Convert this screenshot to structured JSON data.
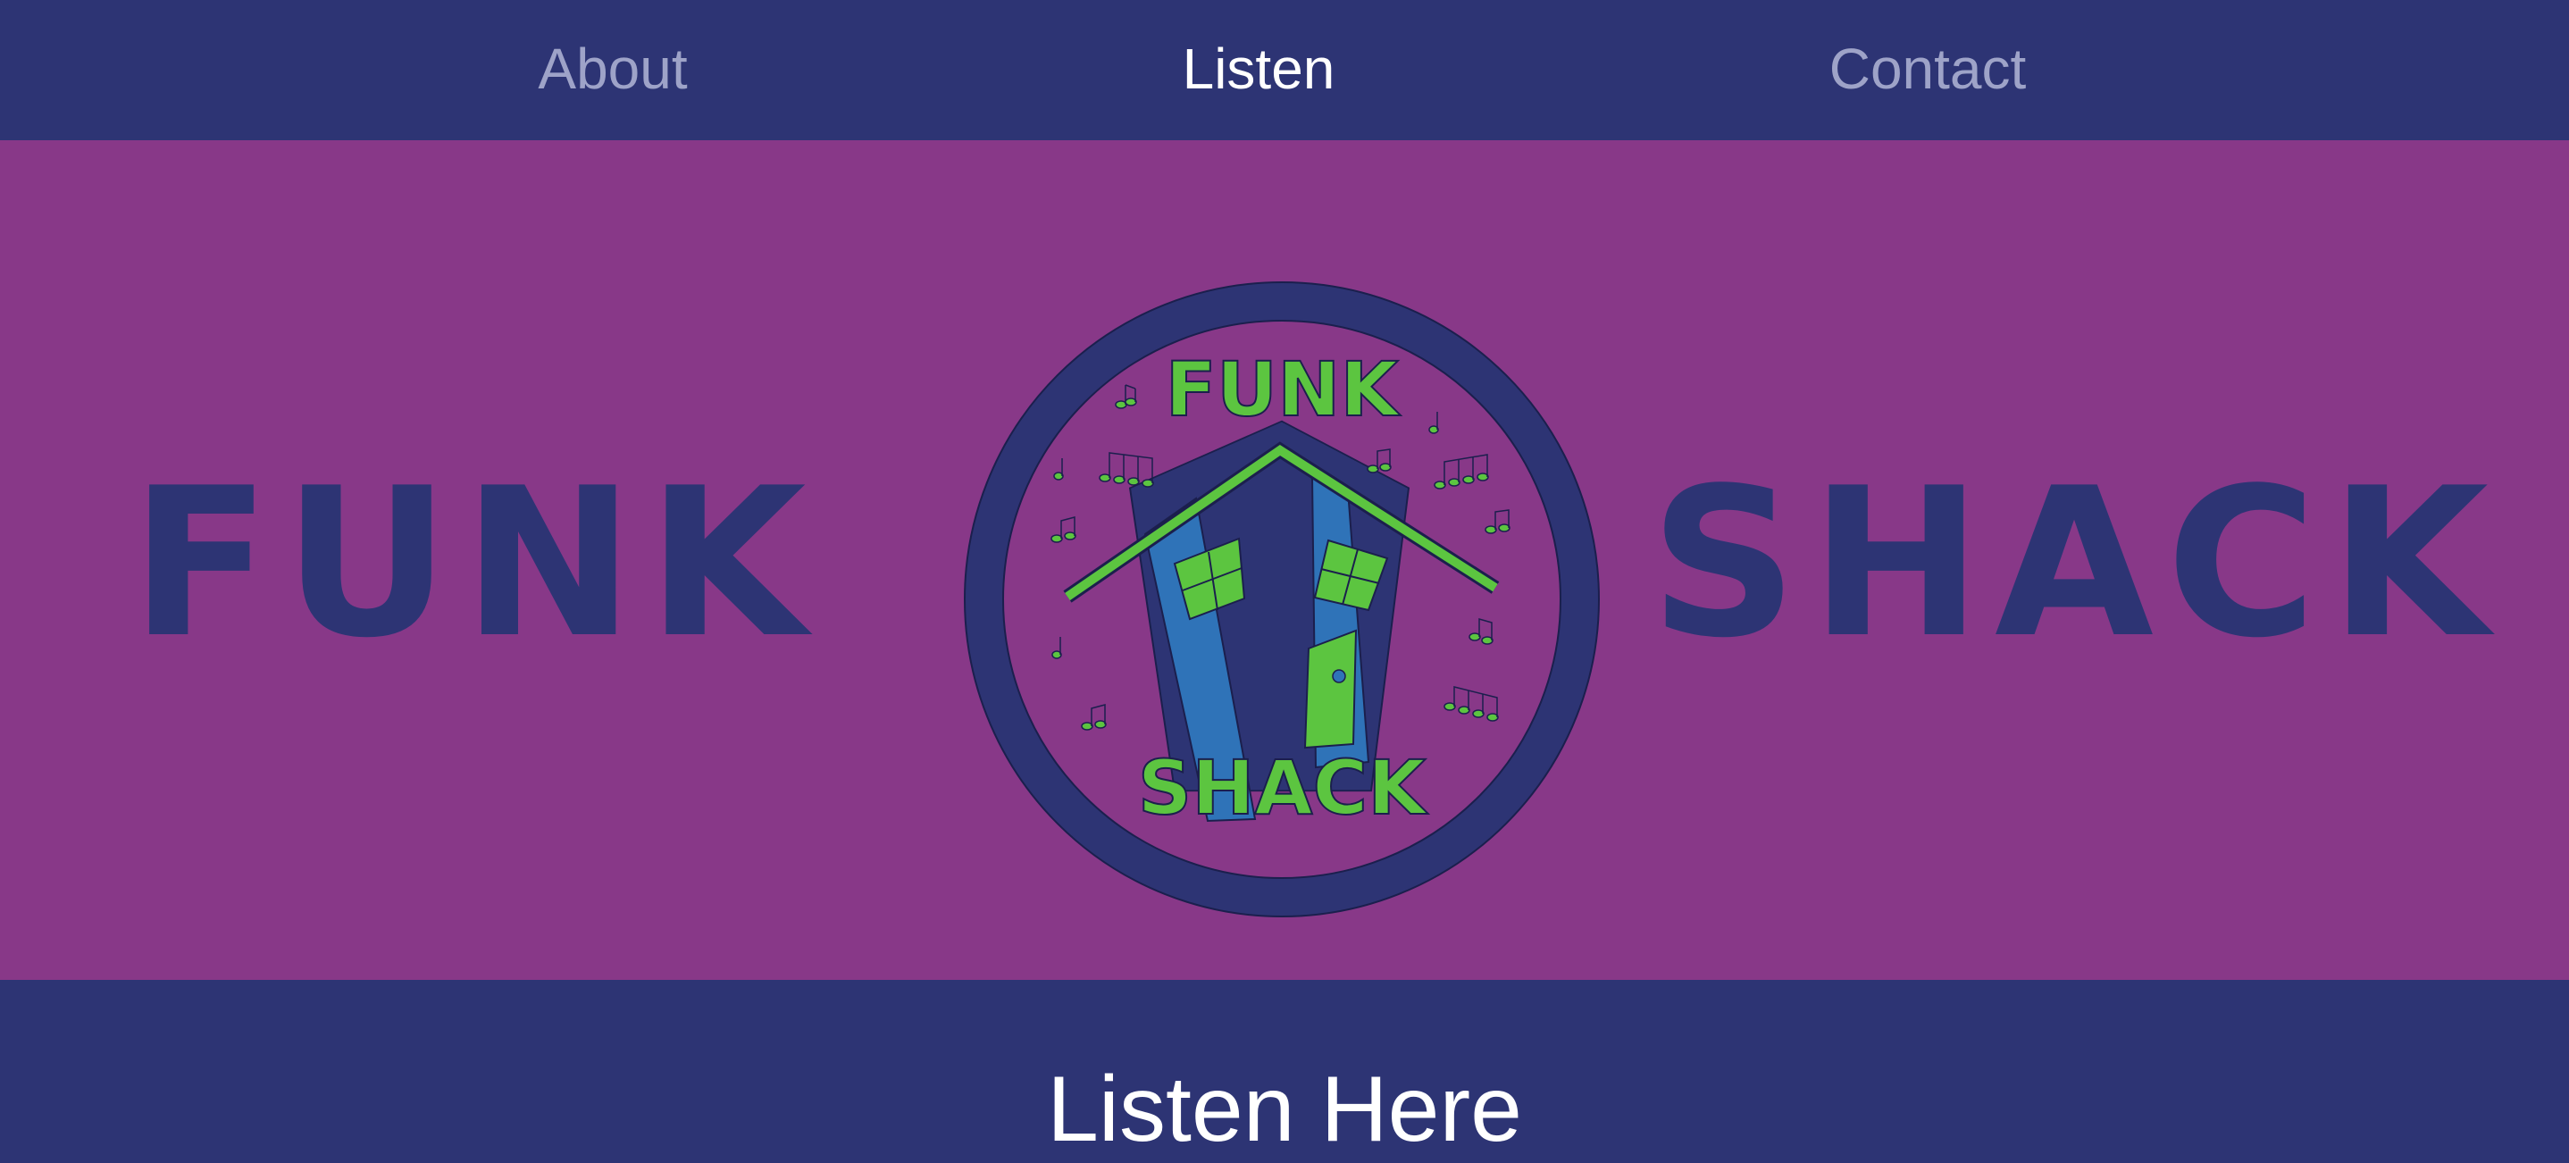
{
  "nav": {
    "items": [
      {
        "label": "About",
        "active": false
      },
      {
        "label": "Listen",
        "active": true
      },
      {
        "label": "Contact",
        "active": false
      }
    ]
  },
  "hero": {
    "left_word": "FUNK",
    "right_word": "SHACK",
    "logo": {
      "top_text": "FUNK",
      "bottom_text": "SHACK",
      "icon": "funk-shack-house-logo"
    }
  },
  "section": {
    "title": "Listen Here"
  },
  "colors": {
    "navy": "#2d3474",
    "purple": "#883888",
    "green": "#5cc540",
    "blue": "#2f73b8",
    "nav_inactive": "#9ea3c8",
    "nav_active": "#ffffff"
  }
}
